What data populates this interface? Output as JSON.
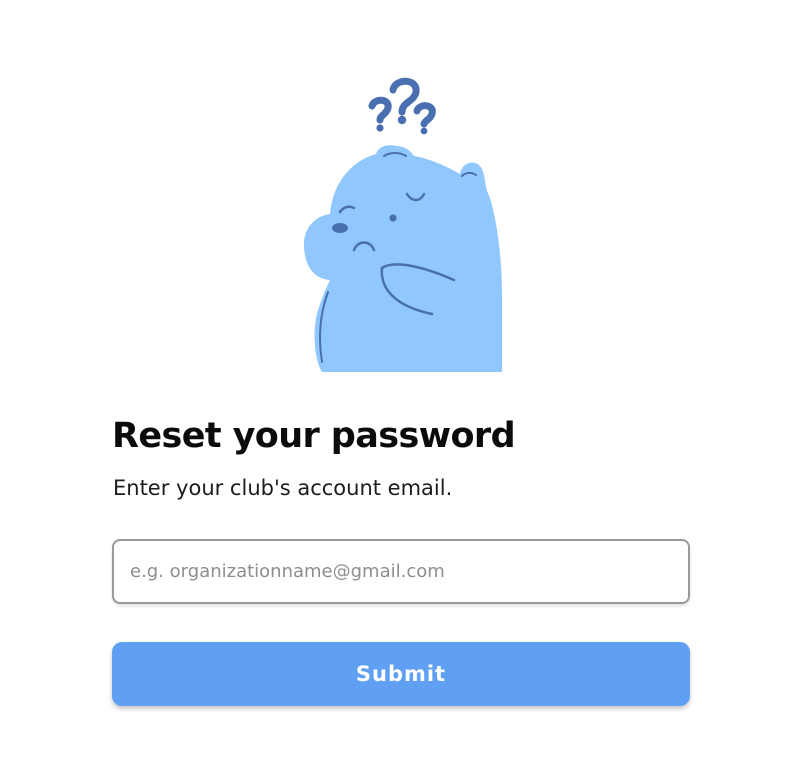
{
  "illustration": {
    "subject": "confused-bear",
    "accent_color": "#90c8fd",
    "line_color": "#4a6fb0"
  },
  "form": {
    "title": "Reset your password",
    "subtitle": "Enter your club's account email.",
    "email_placeholder": "e.g. organizationname@gmail.com",
    "email_value": "",
    "submit_label": "Submit",
    "button_color": "#5fa0f2"
  }
}
